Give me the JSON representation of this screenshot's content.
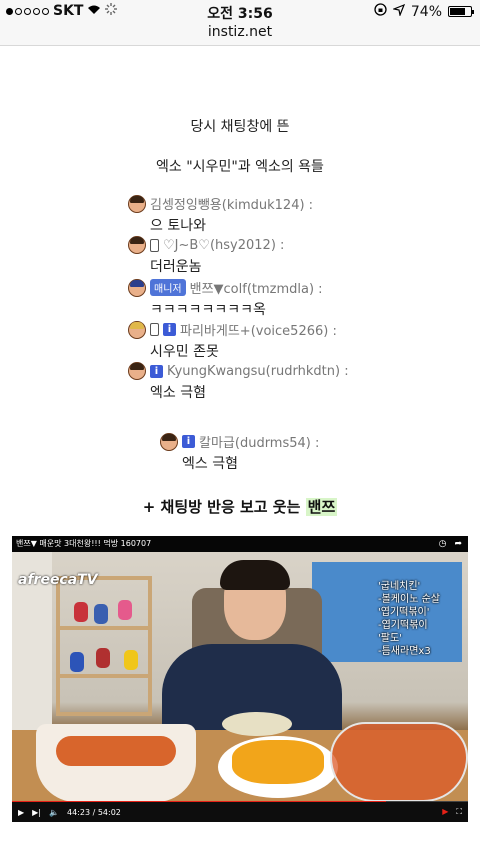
{
  "status_bar": {
    "carrier": "SKT",
    "time": "오전 3:56",
    "battery": "74%",
    "battery_level": 0.74
  },
  "url_bar": {
    "domain": "instiz.net"
  },
  "article": {
    "line1": "당시 채팅창에 뜬",
    "line2": "엑소 \"시우민\"과 엑소의 욕들",
    "chat": [
      {
        "user": "김셍정잉뺑용(kimduk124) :",
        "message": "으 토나와"
      },
      {
        "user": "♡J~B♡(hsy2012) :",
        "message": "더러운놈"
      },
      {
        "badge": "매니저",
        "user": "밴쯔▼colf(tmzmdla) :",
        "message": "ㅋㅋㅋㅋㅋㅋㅋㅋ옥"
      },
      {
        "user": "파리바게뜨+(voice5266) :",
        "message": "시우민 존못"
      },
      {
        "user": "KyungKwangsu(rudrhkdtn) :",
        "message": "엑소 극혐"
      },
      {
        "user": "칼마급(dudrms54) :",
        "message": "엑스 극혐"
      }
    ],
    "tagline_prefix": "+ 채팅방 반응 보고 웃는 ",
    "tagline_highlight": "밴쯔"
  },
  "video": {
    "title": "밴쯔▼ 매운맛 3대천왕!!! 먹방 160707",
    "logo": "afreecaTV",
    "menu": [
      "'굽네치킨'",
      "-볼케이노 순살",
      "'엽기떡볶이'",
      "-엽기떡볶이",
      "'팔도'",
      "-틈새라면x3"
    ],
    "time_current": "44:23",
    "time_total": "54:02",
    "progress": 0.82
  }
}
